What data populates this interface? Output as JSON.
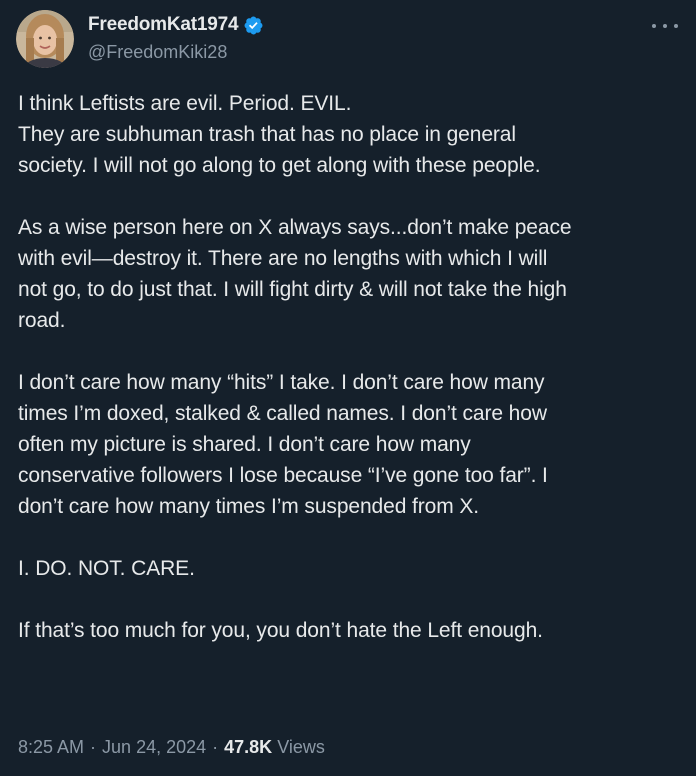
{
  "author": {
    "display_name": "FreedomKat1974",
    "handle": "@FreedomKiki28",
    "verified_color": "#1d9bf0",
    "avatar_icon": "profile-photo"
  },
  "more_menu_icon": "ellipsis-icon",
  "tweet": {
    "lines": [
      "I think Leftists are evil. Period. EVIL.",
      "They are subhuman trash that has no place in general",
      "society. I will not go along to get along with these people.",
      "",
      "As a wise person here on X always says...don’t make peace",
      "with evil—destroy it. There are no lengths with which I will",
      "not go, to do just that. I will fight dirty & will not take the high",
      "road.",
      "",
      "I don’t care how many “hits” I take. I don’t care how many",
      "times I’m doxed, stalked & called names. I don’t care how",
      "often my picture is shared. I don’t care how many",
      "conservative followers I lose because “I’ve gone too far”. I",
      "don’t care how many times I’m suspended from X.",
      "",
      "I. DO. NOT. CARE.",
      "",
      "If that’s too much for you, you don’t hate the Left enough."
    ]
  },
  "meta": {
    "time": "8:25 AM",
    "separator": "·",
    "date": "Jun 24, 2024",
    "views_count": "47.8K",
    "views_label": "Views"
  },
  "colors": {
    "background": "#15202b",
    "text": "#e7e9ea",
    "secondary": "#8b98a5",
    "accent": "#1d9bf0"
  }
}
